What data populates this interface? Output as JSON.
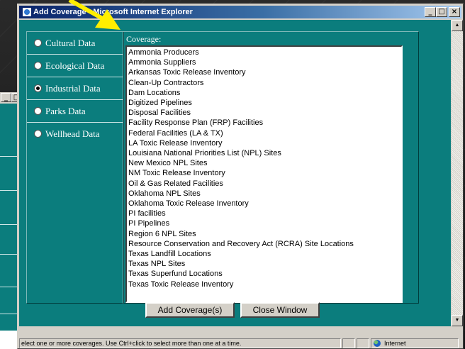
{
  "background_window": {
    "controls": [
      "_",
      "□",
      "×"
    ]
  },
  "window": {
    "title": "Add Coverage - Microsoft Internet Explorer",
    "controls": {
      "minimize": "_",
      "maximize": "□",
      "close": "×"
    }
  },
  "categories": [
    {
      "label": "Cultural Data",
      "checked": false
    },
    {
      "label": "Ecological Data",
      "checked": false
    },
    {
      "label": "Industrial Data",
      "checked": true
    },
    {
      "label": "Parks Data",
      "checked": false
    },
    {
      "label": "Wellhead Data",
      "checked": false
    }
  ],
  "coverage": {
    "label": "Coverage:",
    "items": [
      "Ammonia Producers",
      "Ammonia Suppliers",
      "Arkansas Toxic Release Inventory",
      "Clean-Up Contractors",
      "Dam Locations",
      "Digitized Pipelines",
      "Disposal Facilities",
      "Facility Response Plan (FRP) Facilities",
      "Federal Facilities (LA & TX)",
      "LA Toxic Release Inventory",
      "Louisiana National Priorities List (NPL) Sites",
      "New Mexico NPL Sites",
      "NM Toxic Release Inventory",
      "Oil & Gas Related Facilities",
      "Oklahoma NPL Sites",
      "Oklahoma Toxic Release Inventory",
      "PI facilities",
      "PI Pipelines",
      "Region 6 NPL Sites",
      "Resource Conservation and Recovery Act (RCRA) Site Locations",
      "Texas Landfill Locations",
      "Texas NPL Sites",
      "Texas Superfund Locations",
      "Texas Toxic Release Inventory"
    ]
  },
  "buttons": {
    "add": "Add Coverage(s)",
    "close": "Close Window"
  },
  "status": {
    "message": "elect one or more coverages.  Use Ctrl+click to select more than one at a time.",
    "zone": "Internet"
  },
  "colors": {
    "panel_teal": "#0b7d7d",
    "title_blue": "#0a246a",
    "arrow_yellow": "#ffee00"
  }
}
